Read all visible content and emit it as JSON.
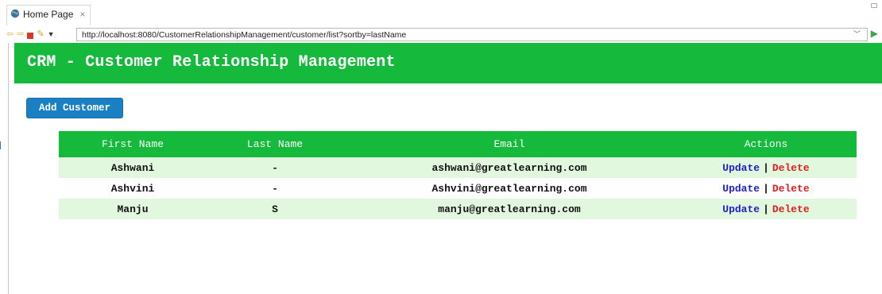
{
  "browser": {
    "tab_title": "Home Page",
    "tab_close": "×",
    "url": "http://localhost:8080/CustomerRelationshipManagement/customer/list?sortby=lastName"
  },
  "header": {
    "title": "CRM - Customer Relationship Management"
  },
  "add_button_label": "Add Customer",
  "table": {
    "columns": [
      "First Name",
      "Last Name",
      "Email",
      "Actions"
    ],
    "rows": [
      {
        "first_name": "Ashwani",
        "last_name": "-",
        "email": "ashwani@greatlearning.com",
        "update": "Update",
        "separator": "|",
        "delete": "Delete"
      },
      {
        "first_name": "Ashvini",
        "last_name": "-",
        "email": "Ashvini@greatlearning.com",
        "update": "Update",
        "separator": "|",
        "delete": "Delete"
      },
      {
        "first_name": "Manju",
        "last_name": "S",
        "email": "manju@greatlearning.com",
        "update": "Update",
        "separator": "|",
        "delete": "Delete"
      }
    ]
  },
  "colors": {
    "header_green": "#15b93b",
    "row_tint": "#e2f8de",
    "button_blue": "#1a80c4",
    "update_link": "#1e1ec8",
    "delete_link": "#e02020"
  }
}
